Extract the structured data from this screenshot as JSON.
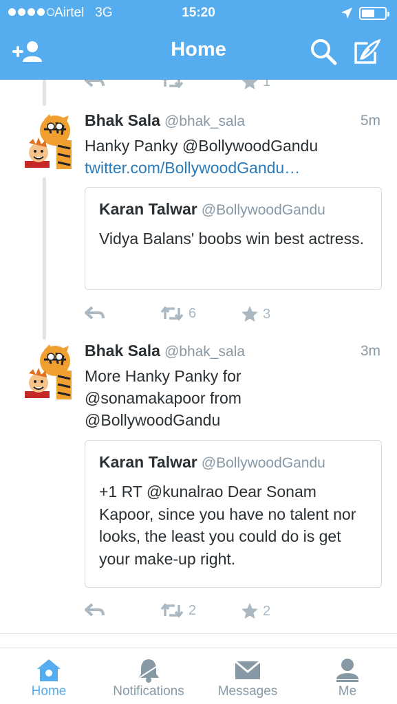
{
  "status_bar": {
    "carrier": "Airtel",
    "network": "3G",
    "time": "15:20"
  },
  "nav": {
    "title": "Home"
  },
  "top_tweet_fragment": {
    "favorite_count": "1"
  },
  "tweets": [
    {
      "name": "Bhak Sala",
      "handle": "@bhak_sala",
      "time": "5m",
      "text": "Hanky Panky @BollywoodGandu",
      "link": "twitter.com/BollywoodGandu…",
      "quote": {
        "name": "Karan Talwar",
        "handle": "@BollywoodGandu",
        "text": "Vidya Balans' boobs win best actress."
      },
      "retweets": "6",
      "favorites": "3"
    },
    {
      "name": "Bhak Sala",
      "handle": "@bhak_sala",
      "time": "3m",
      "text": "More Hanky Panky for @sonamakapoor from @BollywoodGandu",
      "quote": {
        "name": "Karan Talwar",
        "handle": "@BollywoodGandu",
        "text": "+1 RT @kunalrao Dear Sonam Kapoor, since you have no talent nor looks, the least you could do is get your make-up right."
      },
      "retweets": "2",
      "favorites": "2"
    }
  ],
  "tabbar": {
    "home": "Home",
    "notifications": "Notifications",
    "messages": "Messages",
    "me": "Me"
  },
  "colors": {
    "brand": "#55acee",
    "link": "#2b7bb9",
    "muted": "#8899a6",
    "action_gray": "#aab8c2"
  },
  "icons": {
    "add": "add-user-icon",
    "search": "search-icon",
    "compose": "compose-icon",
    "reply": "reply-icon",
    "retweet": "retweet-icon",
    "favorite": "star-icon",
    "home": "home-icon",
    "notifications": "bell-icon",
    "messages": "envelope-icon",
    "me": "person-icon"
  }
}
